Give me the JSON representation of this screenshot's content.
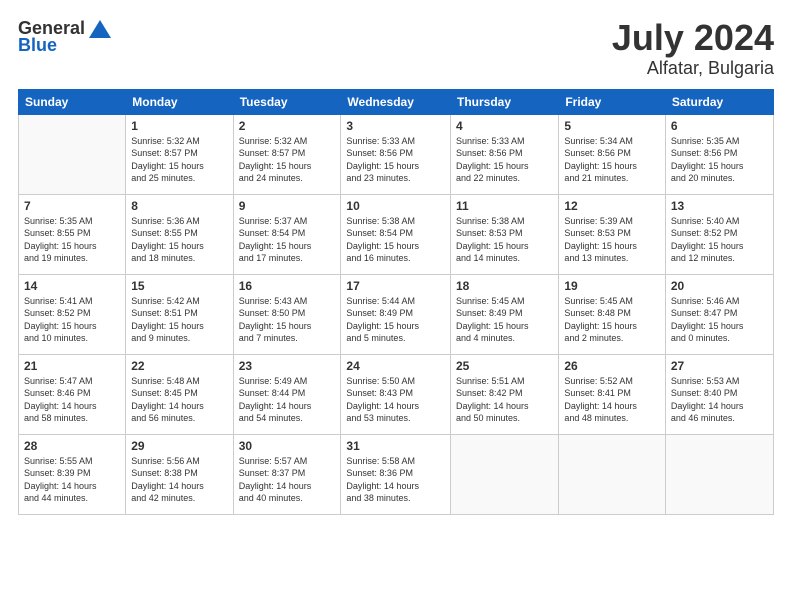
{
  "logo": {
    "general": "General",
    "blue": "Blue"
  },
  "title": {
    "month": "July 2024",
    "location": "Alfatar, Bulgaria"
  },
  "weekdays": [
    "Sunday",
    "Monday",
    "Tuesday",
    "Wednesday",
    "Thursday",
    "Friday",
    "Saturday"
  ],
  "weeks": [
    [
      {
        "day": "",
        "info": ""
      },
      {
        "day": "1",
        "info": "Sunrise: 5:32 AM\nSunset: 8:57 PM\nDaylight: 15 hours\nand 25 minutes."
      },
      {
        "day": "2",
        "info": "Sunrise: 5:32 AM\nSunset: 8:57 PM\nDaylight: 15 hours\nand 24 minutes."
      },
      {
        "day": "3",
        "info": "Sunrise: 5:33 AM\nSunset: 8:56 PM\nDaylight: 15 hours\nand 23 minutes."
      },
      {
        "day": "4",
        "info": "Sunrise: 5:33 AM\nSunset: 8:56 PM\nDaylight: 15 hours\nand 22 minutes."
      },
      {
        "day": "5",
        "info": "Sunrise: 5:34 AM\nSunset: 8:56 PM\nDaylight: 15 hours\nand 21 minutes."
      },
      {
        "day": "6",
        "info": "Sunrise: 5:35 AM\nSunset: 8:56 PM\nDaylight: 15 hours\nand 20 minutes."
      }
    ],
    [
      {
        "day": "7",
        "info": "Sunrise: 5:35 AM\nSunset: 8:55 PM\nDaylight: 15 hours\nand 19 minutes."
      },
      {
        "day": "8",
        "info": "Sunrise: 5:36 AM\nSunset: 8:55 PM\nDaylight: 15 hours\nand 18 minutes."
      },
      {
        "day": "9",
        "info": "Sunrise: 5:37 AM\nSunset: 8:54 PM\nDaylight: 15 hours\nand 17 minutes."
      },
      {
        "day": "10",
        "info": "Sunrise: 5:38 AM\nSunset: 8:54 PM\nDaylight: 15 hours\nand 16 minutes."
      },
      {
        "day": "11",
        "info": "Sunrise: 5:38 AM\nSunset: 8:53 PM\nDaylight: 15 hours\nand 14 minutes."
      },
      {
        "day": "12",
        "info": "Sunrise: 5:39 AM\nSunset: 8:53 PM\nDaylight: 15 hours\nand 13 minutes."
      },
      {
        "day": "13",
        "info": "Sunrise: 5:40 AM\nSunset: 8:52 PM\nDaylight: 15 hours\nand 12 minutes."
      }
    ],
    [
      {
        "day": "14",
        "info": "Sunrise: 5:41 AM\nSunset: 8:52 PM\nDaylight: 15 hours\nand 10 minutes."
      },
      {
        "day": "15",
        "info": "Sunrise: 5:42 AM\nSunset: 8:51 PM\nDaylight: 15 hours\nand 9 minutes."
      },
      {
        "day": "16",
        "info": "Sunrise: 5:43 AM\nSunset: 8:50 PM\nDaylight: 15 hours\nand 7 minutes."
      },
      {
        "day": "17",
        "info": "Sunrise: 5:44 AM\nSunset: 8:49 PM\nDaylight: 15 hours\nand 5 minutes."
      },
      {
        "day": "18",
        "info": "Sunrise: 5:45 AM\nSunset: 8:49 PM\nDaylight: 15 hours\nand 4 minutes."
      },
      {
        "day": "19",
        "info": "Sunrise: 5:45 AM\nSunset: 8:48 PM\nDaylight: 15 hours\nand 2 minutes."
      },
      {
        "day": "20",
        "info": "Sunrise: 5:46 AM\nSunset: 8:47 PM\nDaylight: 15 hours\nand 0 minutes."
      }
    ],
    [
      {
        "day": "21",
        "info": "Sunrise: 5:47 AM\nSunset: 8:46 PM\nDaylight: 14 hours\nand 58 minutes."
      },
      {
        "day": "22",
        "info": "Sunrise: 5:48 AM\nSunset: 8:45 PM\nDaylight: 14 hours\nand 56 minutes."
      },
      {
        "day": "23",
        "info": "Sunrise: 5:49 AM\nSunset: 8:44 PM\nDaylight: 14 hours\nand 54 minutes."
      },
      {
        "day": "24",
        "info": "Sunrise: 5:50 AM\nSunset: 8:43 PM\nDaylight: 14 hours\nand 53 minutes."
      },
      {
        "day": "25",
        "info": "Sunrise: 5:51 AM\nSunset: 8:42 PM\nDaylight: 14 hours\nand 50 minutes."
      },
      {
        "day": "26",
        "info": "Sunrise: 5:52 AM\nSunset: 8:41 PM\nDaylight: 14 hours\nand 48 minutes."
      },
      {
        "day": "27",
        "info": "Sunrise: 5:53 AM\nSunset: 8:40 PM\nDaylight: 14 hours\nand 46 minutes."
      }
    ],
    [
      {
        "day": "28",
        "info": "Sunrise: 5:55 AM\nSunset: 8:39 PM\nDaylight: 14 hours\nand 44 minutes."
      },
      {
        "day": "29",
        "info": "Sunrise: 5:56 AM\nSunset: 8:38 PM\nDaylight: 14 hours\nand 42 minutes."
      },
      {
        "day": "30",
        "info": "Sunrise: 5:57 AM\nSunset: 8:37 PM\nDaylight: 14 hours\nand 40 minutes."
      },
      {
        "day": "31",
        "info": "Sunrise: 5:58 AM\nSunset: 8:36 PM\nDaylight: 14 hours\nand 38 minutes."
      },
      {
        "day": "",
        "info": ""
      },
      {
        "day": "",
        "info": ""
      },
      {
        "day": "",
        "info": ""
      }
    ]
  ]
}
